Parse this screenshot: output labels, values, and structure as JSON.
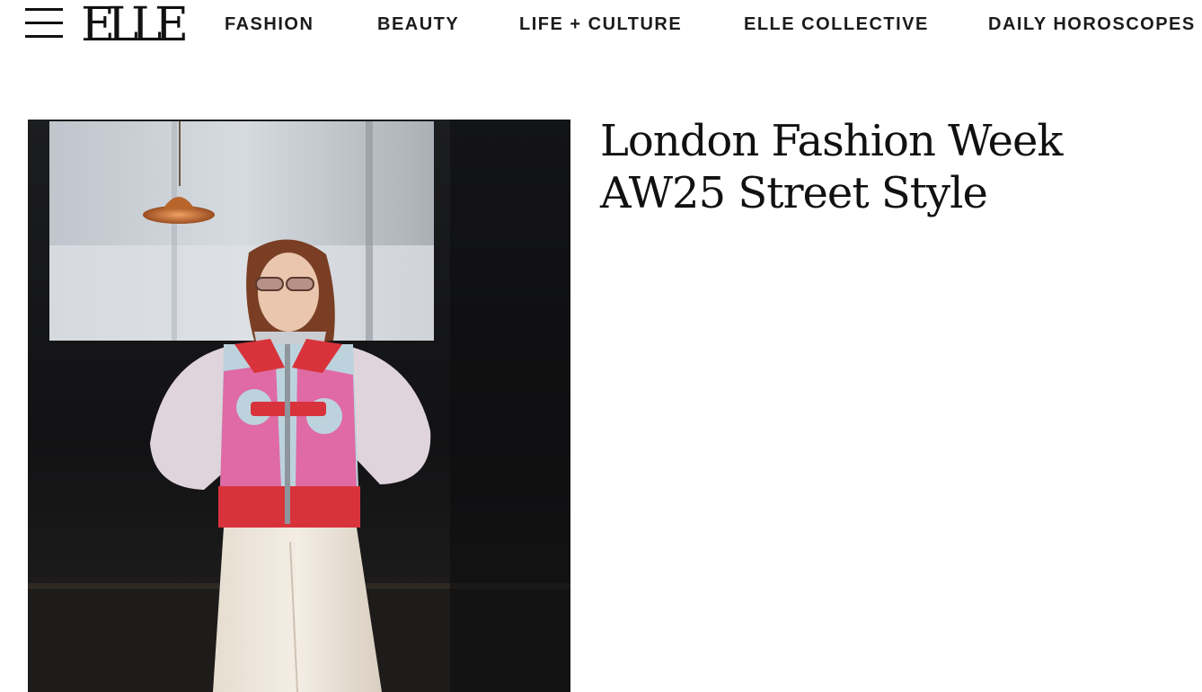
{
  "header": {
    "menu_icon": "hamburger-menu-icon",
    "logo_text": "ELLE",
    "nav": [
      {
        "label": "FASHION"
      },
      {
        "label": "BEAUTY"
      },
      {
        "label": "LIFE + CULTURE"
      },
      {
        "label": "ELLE COLLECTIVE"
      },
      {
        "label": "DAILY HOROSCOPES"
      }
    ]
  },
  "article": {
    "title_line1": "London Fashion Week",
    "title_line2": "AW25 Street Style"
  },
  "colors": {
    "text": "#111111",
    "background": "#ffffff",
    "jacket_red": "#d8333a",
    "jacket_pink": "#e5579a"
  }
}
